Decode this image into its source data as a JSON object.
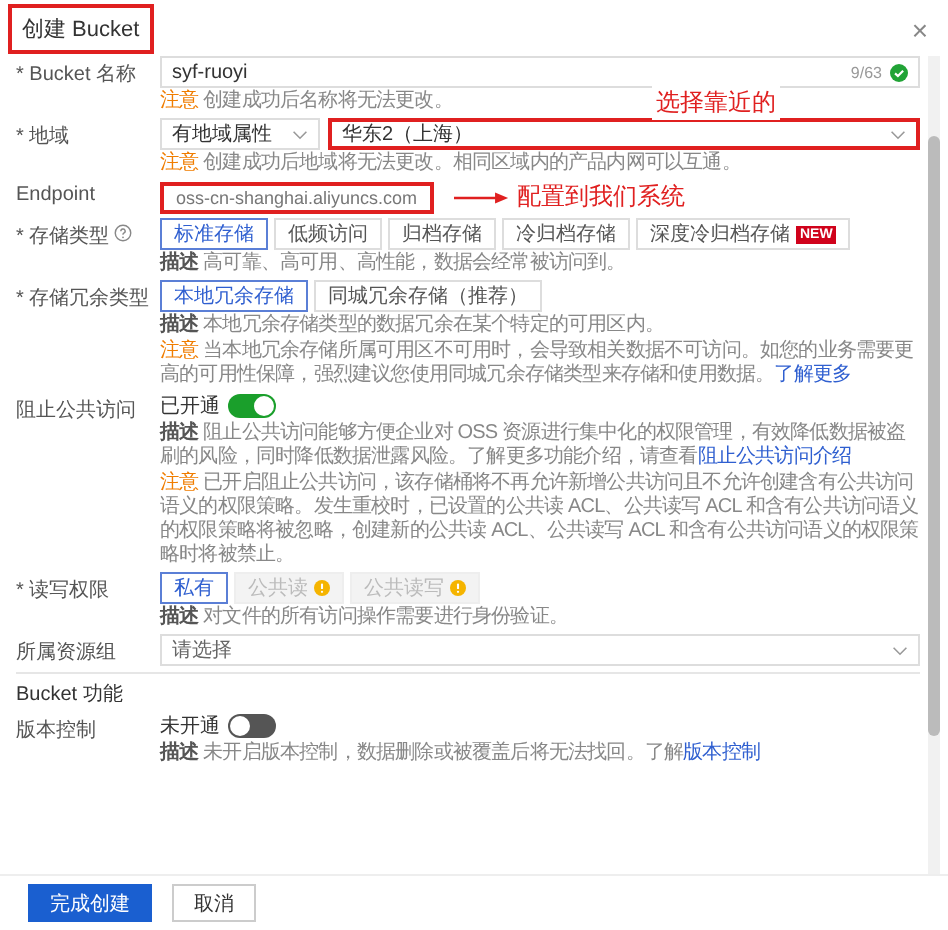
{
  "dialog": {
    "title": "创建 Bucket",
    "title_highlighted": true,
    "close": "×"
  },
  "fields": [
    {
      "kind": "input",
      "label": "* Bucket 名称",
      "value": "syf-ruoyi",
      "counter": "9/63",
      "valid": true,
      "notes": [
        {
          "kind": "note",
          "tag": "注意",
          "text": "创建成功后名称将无法更改。"
        }
      ]
    },
    {
      "kind": "selects",
      "label": "* 地域",
      "selects": [
        {
          "value": "有地域属性",
          "highlighted": false
        },
        {
          "value": "华东2（上海）",
          "highlighted": true
        }
      ],
      "annotation": "选择靠近的",
      "notes": [
        {
          "kind": "note",
          "tag": "注意",
          "text": "创建成功后地域将无法更改。相同区域内的产品内网可以互通。"
        }
      ]
    },
    {
      "kind": "readonly",
      "label": "Endpoint",
      "value": "oss-cn-shanghai.aliyuncs.com",
      "highlighted": true,
      "annotation": "配置到我们系统"
    },
    {
      "kind": "options",
      "label": "* 存储类型",
      "help": true,
      "options": [
        {
          "label": "标准存储",
          "selected": true,
          "disabled": false
        },
        {
          "label": "低频访问",
          "selected": false,
          "disabled": false
        },
        {
          "label": "归档存储",
          "selected": false,
          "disabled": false
        },
        {
          "label": "冷归档存储",
          "selected": false,
          "disabled": false
        },
        {
          "label": "深度冷归档存储",
          "selected": false,
          "disabled": false,
          "badge": "NEW"
        }
      ],
      "notes": [
        {
          "kind": "desc",
          "tag": "描述",
          "text": "高可靠、高可用、高性能，数据会经常被访问到。"
        }
      ]
    },
    {
      "kind": "options",
      "label": "* 存储冗余类型",
      "options": [
        {
          "label": "本地冗余存储",
          "selected": true,
          "disabled": false
        },
        {
          "label": "同城冗余存储（推荐）",
          "selected": false,
          "disabled": false
        }
      ],
      "notes": [
        {
          "kind": "desc",
          "tag": "描述",
          "text": "本地冗余存储类型的数据冗余在某个特定的可用区内。"
        },
        {
          "kind": "note",
          "tag": "注意",
          "text": "当本地冗余存储所属可用区不可用时，会导致相关数据不可访问。如您的业务需要更高的可用性保障，强烈建议您使用同城冗余存储类型来存储和使用数据。",
          "link": "了解更多"
        }
      ]
    },
    {
      "kind": "toggle",
      "label": "阻止公共访问",
      "on": true,
      "state": "已开通",
      "notes": [
        {
          "kind": "desc",
          "tag": "描述",
          "text": "阻止公共访问能够方便企业对 OSS 资源进行集中化的权限管理，有效降低数据被盗刷的风险，同时降低数据泄露风险。了解更多功能介绍，请查看",
          "link": "阻止公共访问介绍"
        },
        {
          "kind": "note",
          "tag": "注意",
          "text": "已开启阻止公共访问，该存储桶将不再允许新增公共访问且不允许创建含有公共访问语义的权限策略。发生重校时，已设置的公共读 ACL、公共读写 ACL 和含有公共访问语义的权限策略将被忽略，创建新的公共读 ACL、公共读写 ACL 和含有公共访问语义的权限策略时将被禁止。"
        }
      ]
    },
    {
      "kind": "options",
      "label": "* 读写权限",
      "options": [
        {
          "label": "私有",
          "selected": true,
          "disabled": false
        },
        {
          "label": "公共读",
          "selected": false,
          "disabled": true,
          "warning": true
        },
        {
          "label": "公共读写",
          "selected": false,
          "disabled": true,
          "warning": true
        }
      ],
      "notes": [
        {
          "kind": "desc",
          "tag": "描述",
          "text": "对文件的所有访问操作需要进行身份验证。"
        }
      ]
    },
    {
      "kind": "select",
      "label": "所属资源组",
      "placeholder": "请选择"
    },
    {
      "kind": "section",
      "label": "Bucket 功能"
    },
    {
      "kind": "toggle",
      "label": "版本控制",
      "on": false,
      "state": "未开通",
      "notes": [
        {
          "kind": "desc",
          "tag": "描述",
          "text": "未开启版本控制，数据删除或被覆盖后将无法找回。了解",
          "link": "版本控制"
        }
      ]
    }
  ],
  "footer": {
    "buttons": [
      {
        "label": "完成创建",
        "primary": true
      },
      {
        "label": "取消",
        "primary": false
      }
    ]
  }
}
